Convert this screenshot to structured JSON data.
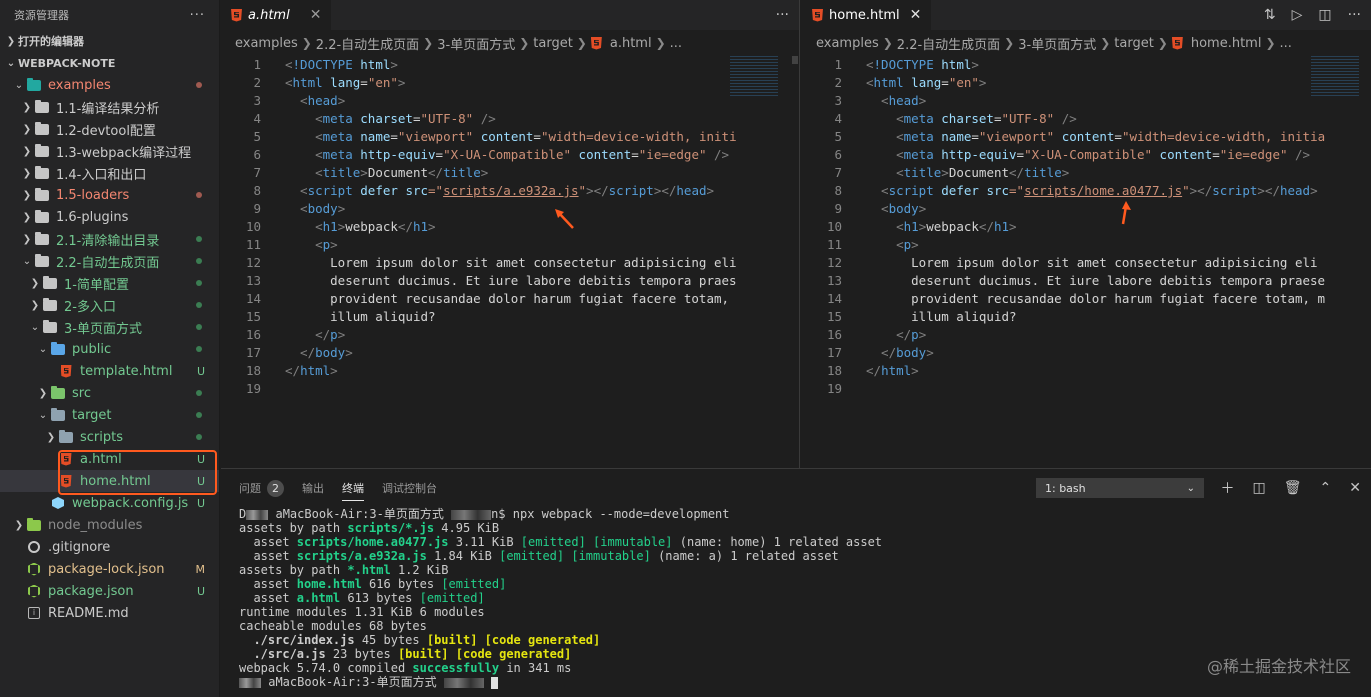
{
  "sidebar": {
    "title": "资源管理器",
    "more": "···",
    "open_editors": "打开的编辑器",
    "project": "WEBPACK-NOTE",
    "items": [
      {
        "label": "examples",
        "color": "#f48771",
        "badge": "",
        "dot": "#a05a50"
      },
      {
        "label": "1.1-编译结果分析",
        "color": "#cccccc",
        "badge": "",
        "dot": ""
      },
      {
        "label": "1.2-devtool配置",
        "color": "#cccccc",
        "badge": "",
        "dot": ""
      },
      {
        "label": "1.3-webpack编译过程",
        "color": "#cccccc",
        "badge": "",
        "dot": ""
      },
      {
        "label": "1.4-入口和出口",
        "color": "#cccccc",
        "badge": "",
        "dot": ""
      },
      {
        "label": "1.5-loaders",
        "color": "#f48771",
        "badge": "",
        "dot": "#a05a50"
      },
      {
        "label": "1.6-plugins",
        "color": "#cccccc",
        "badge": "",
        "dot": ""
      },
      {
        "label": "2.1-清除输出目录",
        "color": "#73c991",
        "badge": "",
        "dot": "#3b7d52"
      },
      {
        "label": "2.2-自动生成页面",
        "color": "#73c991",
        "badge": "",
        "dot": "#3b7d52"
      },
      {
        "label": "1-简单配置",
        "color": "#73c991",
        "badge": "",
        "dot": "#3b7d52"
      },
      {
        "label": "2-多入口",
        "color": "#73c991",
        "badge": "",
        "dot": "#3b7d52"
      },
      {
        "label": "3-单页面方式",
        "color": "#73c991",
        "badge": "",
        "dot": "#3b7d52"
      },
      {
        "label": "public",
        "color": "#73c991",
        "badge": "",
        "dot": "#3b7d52"
      },
      {
        "label": "template.html",
        "color": "#73c991",
        "badge": "U",
        "dot": ""
      },
      {
        "label": "src",
        "color": "#73c991",
        "badge": "",
        "dot": "#3b7d52"
      },
      {
        "label": "target",
        "color": "#73c991",
        "badge": "",
        "dot": "#3b7d52"
      },
      {
        "label": "scripts",
        "color": "#73c991",
        "badge": "",
        "dot": "#3b7d52"
      },
      {
        "label": "a.html",
        "color": "#73c991",
        "badge": "U",
        "dot": ""
      },
      {
        "label": "home.html",
        "color": "#73c991",
        "badge": "U",
        "dot": ""
      },
      {
        "label": "webpack.config.js",
        "color": "#73c991",
        "badge": "U",
        "dot": ""
      },
      {
        "label": "node_modules",
        "color": "#8c8c8c",
        "badge": "",
        "dot": ""
      },
      {
        "label": ".gitignore",
        "color": "#cccccc",
        "badge": "",
        "dot": ""
      },
      {
        "label": "package-lock.json",
        "color": "#e2c08d",
        "badge": "M",
        "dot": ""
      },
      {
        "label": "package.json",
        "color": "#73c991",
        "badge": "U",
        "dot": ""
      },
      {
        "label": "README.md",
        "color": "#cccccc",
        "badge": "",
        "dot": ""
      }
    ]
  },
  "editor_a": {
    "tab_label": "a.html",
    "breadcrumb": [
      "examples",
      "2.2-自动生成页面",
      "3-单页面方式",
      "target",
      "a.html",
      "..."
    ],
    "script_src": "scripts/a.e932a.js"
  },
  "editor_b": {
    "tab_label": "home.html",
    "breadcrumb": [
      "examples",
      "2.2-自动生成页面",
      "3-单页面方式",
      "target",
      "home.html",
      "..."
    ],
    "script_src": "scripts/home.a0477.js"
  },
  "code": {
    "doctype_kw": "!DOCTYPE",
    "html_word": "html",
    "lang_attr": "lang",
    "lang_val": "\"en\"",
    "head": "head",
    "meta": "meta",
    "charset_attr": "charset",
    "charset_val": "\"UTF-8\"",
    "name_attr": "name",
    "name_val": "\"viewport\"",
    "content_attr": "content",
    "content_val_a": "\"width=device-width, initi",
    "content_val_b": "\"width=device-width, initia",
    "http_attr": "http-equiv",
    "http_val": "\"X-UA-Compatible\"",
    "ie_val": "\"ie=edge\"",
    "title": "title",
    "title_text": "Document",
    "script": "script",
    "defer": "defer",
    "src_attr": "src",
    "body": "body",
    "h1": "h1",
    "h1_text": "webpack",
    "p": "p",
    "p1_a": "Lorem ipsum dolor sit amet consectetur adipisicing eli",
    "p1_b": "Lorem ipsum dolor sit amet consectetur adipisicing eli",
    "p2_a": "deserunt ducimus. Et iure labore debitis tempora praes",
    "p2_b": "deserunt ducimus. Et iure labore debitis tempora praese",
    "p3_a": "provident recusandae dolor harum fugiat facere totam,",
    "p3_b": "provident recusandae dolor harum fugiat facere totam, m",
    "p4": "illum aliquid?"
  },
  "panel": {
    "tabs": [
      "问题",
      "输出",
      "终端",
      "调试控制台"
    ],
    "problems_count": "2",
    "terminal_select": "1: bash",
    "terminal": {
      "l1_pre": "D",
      "l1_host": "aMacBook-Air:3-单页面方式",
      "l1_cmd": "n$ npx webpack --mode=development",
      "l2": "assets by path ",
      "l2_path": "scripts/*.js",
      "l2_size": " 4.95 KiB",
      "l3_pre": "  asset ",
      "l3_file": "scripts/home.a0477.js",
      "l3_size": " 3.11 KiB ",
      "emitted": "[emitted]",
      "immutable": "[immutable]",
      "l3_rest": " (name: home) 1 related asset",
      "l4_file": "scripts/a.e932a.js",
      "l4_size": " 1.84 KiB ",
      "l4_rest": " (name: a) 1 related asset",
      "l5_path": "*.html",
      "l5_size": " 1.2 KiB",
      "l6_file": "home.html",
      "l6_size": " 616 bytes ",
      "l7_file": "a.html",
      "l7_size": " 613 bytes ",
      "l8": "runtime modules 1.31 KiB 6 modules",
      "l9": "cacheable modules 68 bytes",
      "l10_file": "  ./src/index.js",
      "l10_size": " 45 bytes ",
      "l11_file": "  ./src/a.js",
      "l11_size": " 23 bytes ",
      "built": "[built]",
      "code_generated": "[code generated]",
      "l12_pre": "webpack 5.74.0 compiled ",
      "l12_ok": "successfully",
      "l12_post": " in 341 ms",
      "l13_host": "aMacBook-Air:3-单页面方式"
    }
  },
  "watermark": "@稀土掘金技术社区"
}
